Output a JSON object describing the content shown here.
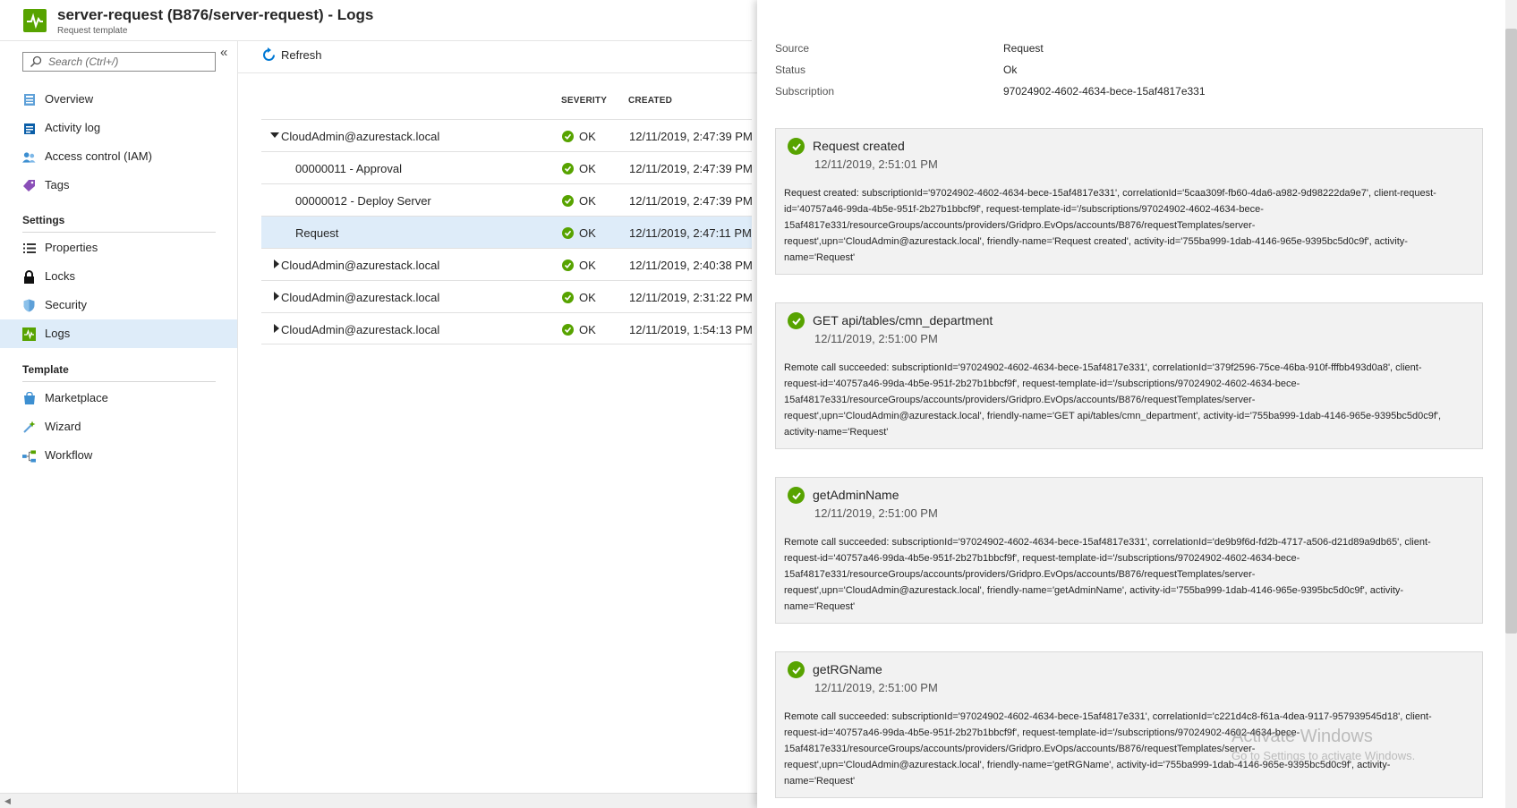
{
  "header": {
    "title": "server-request (B876/server-request) - Logs",
    "subtitle": "Request template"
  },
  "sidebar": {
    "search_placeholder": "Search (Ctrl+/)",
    "collapse_glyph": "«",
    "items_top": [
      {
        "label": "Overview",
        "icon": "overview-icon"
      },
      {
        "label": "Activity log",
        "icon": "activity-log-icon"
      },
      {
        "label": "Access control (IAM)",
        "icon": "access-control-icon"
      },
      {
        "label": "Tags",
        "icon": "tag-icon"
      }
    ],
    "settings_title": "Settings",
    "items_settings": [
      {
        "label": "Properties",
        "icon": "properties-icon"
      },
      {
        "label": "Locks",
        "icon": "lock-icon"
      },
      {
        "label": "Security",
        "icon": "shield-icon"
      },
      {
        "label": "Logs",
        "icon": "logs-icon",
        "selected": true
      }
    ],
    "template_title": "Template",
    "items_template": [
      {
        "label": "Marketplace",
        "icon": "marketplace-icon"
      },
      {
        "label": "Wizard",
        "icon": "wizard-icon"
      },
      {
        "label": "Workflow",
        "icon": "workflow-icon"
      }
    ]
  },
  "toolbar": {
    "refresh_label": "Refresh"
  },
  "grid": {
    "columns": [
      "SEVERITY",
      "CREATED"
    ],
    "rows": [
      {
        "name": "CloudAdmin@azurestack.local",
        "expanded": true,
        "level": 0,
        "severity": "OK",
        "created": "12/11/2019, 2:47:39 PM"
      },
      {
        "name": "00000011 - Approval",
        "level": 1,
        "severity": "OK",
        "created": "12/11/2019, 2:47:39 PM"
      },
      {
        "name": "00000012 - Deploy Server",
        "level": 1,
        "severity": "OK",
        "created": "12/11/2019, 2:47:39 PM"
      },
      {
        "name": "Request",
        "level": 1,
        "selected": true,
        "severity": "OK",
        "created": "12/11/2019, 2:47:11 PM"
      },
      {
        "name": "CloudAdmin@azurestack.local",
        "expanded": false,
        "level": 0,
        "severity": "OK",
        "created": "12/11/2019, 2:40:38 PM"
      },
      {
        "name": "CloudAdmin@azurestack.local",
        "expanded": false,
        "level": 0,
        "severity": "OK",
        "created": "12/11/2019, 2:31:22 PM"
      },
      {
        "name": "CloudAdmin@azurestack.local",
        "expanded": false,
        "level": 0,
        "severity": "OK",
        "created": "12/11/2019, 1:54:13 PM"
      }
    ]
  },
  "detail": {
    "properties": [
      {
        "label": "Source",
        "value": "Request"
      },
      {
        "label": "Status",
        "value": "Ok"
      },
      {
        "label": "Subscription",
        "value": "97024902-4602-4634-bece-15af4817e331"
      }
    ],
    "events": [
      {
        "title": "Request created",
        "date": "12/11/2019, 2:51:01 PM",
        "body": "Request created: subscriptionId='97024902-4602-4634-bece-15af4817e331', correlationId='5caa309f-fb60-4da6-a982-9d98222da9e7', client-request-id='40757a46-99da-4b5e-951f-2b27b1bbcf9f', request-template-id='/subscriptions/97024902-4602-4634-bece-15af4817e331/resourceGroups/accounts/providers/Gridpro.EvOps/accounts/B876/requestTemplates/server-request',upn='CloudAdmin@azurestack.local', friendly-name='Request created', activity-id='755ba999-1dab-4146-965e-9395bc5d0c9f', activity-name='Request'"
      },
      {
        "title": "GET api/tables/cmn_department",
        "date": "12/11/2019, 2:51:00 PM",
        "body": "Remote call succeeded: subscriptionId='97024902-4602-4634-bece-15af4817e331', correlationId='379f2596-75ce-46ba-910f-fffbb493d0a8', client-request-id='40757a46-99da-4b5e-951f-2b27b1bbcf9f', request-template-id='/subscriptions/97024902-4602-4634-bece-15af4817e331/resourceGroups/accounts/providers/Gridpro.EvOps/accounts/B876/requestTemplates/server-request',upn='CloudAdmin@azurestack.local', friendly-name='GET api/tables/cmn_department', activity-id='755ba999-1dab-4146-965e-9395bc5d0c9f', activity-name='Request'"
      },
      {
        "title": "getAdminName",
        "date": "12/11/2019, 2:51:00 PM",
        "body": "Remote call succeeded: subscriptionId='97024902-4602-4634-bece-15af4817e331', correlationId='de9b9f6d-fd2b-4717-a506-d21d89a9db65', client-request-id='40757a46-99da-4b5e-951f-2b27b1bbcf9f', request-template-id='/subscriptions/97024902-4602-4634-bece-15af4817e331/resourceGroups/accounts/providers/Gridpro.EvOps/accounts/B876/requestTemplates/server-request',upn='CloudAdmin@azurestack.local', friendly-name='getAdminName', activity-id='755ba999-1dab-4146-965e-9395bc5d0c9f', activity-name='Request'"
      },
      {
        "title": "getRGName",
        "date": "12/11/2019, 2:51:00 PM",
        "body": "Remote call succeeded: subscriptionId='97024902-4602-4634-bece-15af4817e331', correlationId='c221d4c8-f61a-4dea-9117-957939545d18', client-request-id='40757a46-99da-4b5e-951f-2b27b1bbcf9f', request-template-id='/subscriptions/97024902-4602-4634-bece-15af4817e331/resourceGroups/accounts/providers/Gridpro.EvOps/accounts/B876/requestTemplates/server-request',upn='CloudAdmin@azurestack.local', friendly-name='getRGName', activity-id='755ba999-1dab-4146-965e-9395bc5d0c9f', activity-name='Request'"
      }
    ]
  },
  "watermark": {
    "line1": "Activate Windows",
    "line2": "Go to Settings to activate Windows."
  },
  "colors": {
    "accent": "#0078d4",
    "success": "#57a300",
    "selected_bg": "#deecf9"
  }
}
